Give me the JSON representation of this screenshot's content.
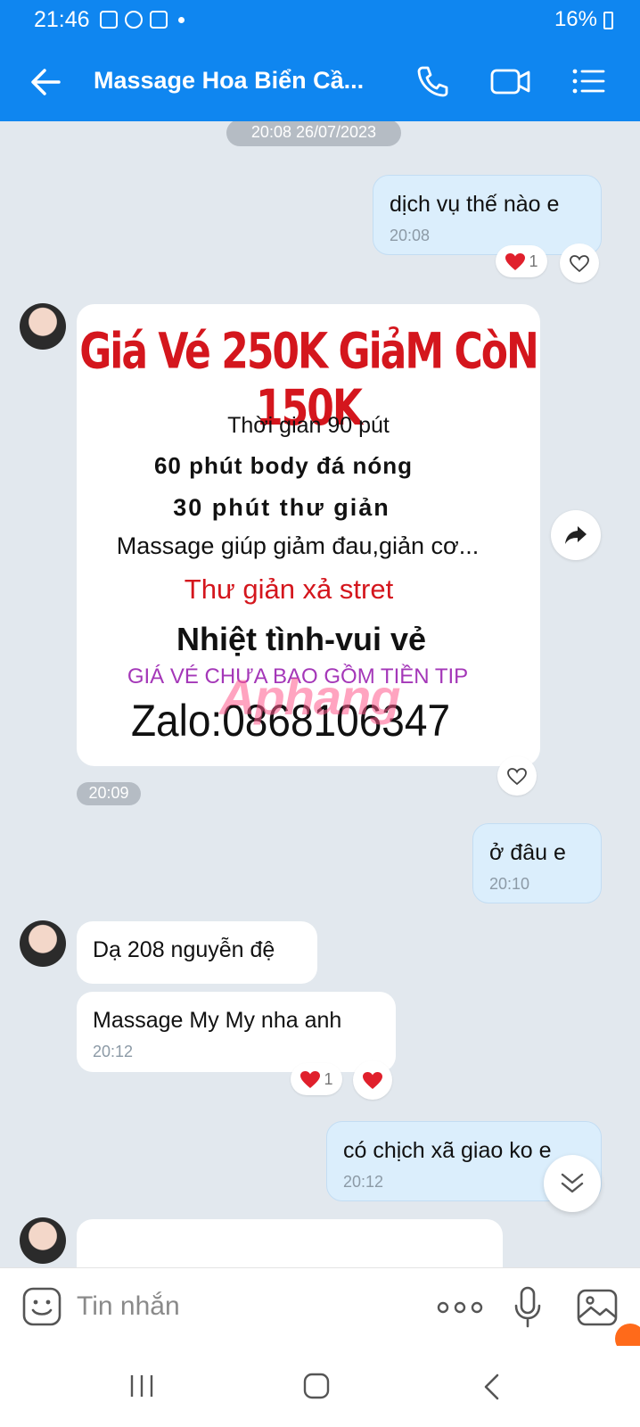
{
  "status_bar": {
    "time": "21:46",
    "battery": "16%"
  },
  "header": {
    "title": "Massage Hoa Biển Cầ...",
    "icons": [
      "back-arrow-icon",
      "phone-icon",
      "video-call-icon",
      "menu-list-icon"
    ]
  },
  "messages": [
    {
      "type": "date",
      "text": "20:08 26/07/2023"
    },
    {
      "type": "outgoing",
      "text": "dịch vụ thế nào e",
      "time": "20:08",
      "reaction_count": "1"
    },
    {
      "type": "incoming_image",
      "time": "20:09",
      "image_lines": {
        "headline": "Giá Vé 250K GiảM CòN 150K",
        "line2": "Thời gian 90 pút",
        "line3": "60 phút body đá nóng",
        "line4": "30 phút thư giản",
        "line5": "Massage giúp giảm đau,giản cơ...",
        "line6": "Thư giản xả stret",
        "line7": "Nhiệt tình-vui vẻ",
        "line8": "GIÁ VÉ CHƯA BAO GỒM TIỀN TIP",
        "line9": "Zalo:0868106347",
        "watermark": "Aphang"
      }
    },
    {
      "type": "outgoing",
      "text": "ở đâu e",
      "time": "20:10"
    },
    {
      "type": "incoming",
      "text": "Dạ 208 nguyễn đệ"
    },
    {
      "type": "incoming",
      "text": "Massage My My nha anh",
      "time": "20:12",
      "reaction_count": "1"
    },
    {
      "type": "outgoing",
      "text": "có chịch xã giao ko e",
      "time": "20:12"
    }
  ],
  "input": {
    "placeholder": "Tin nhắn"
  },
  "colors": {
    "header_bg": "#0f86f0",
    "outgoing_bubble": "#dbeefc",
    "chat_bg": "#e2e8ee",
    "heart": "#e0202c"
  }
}
